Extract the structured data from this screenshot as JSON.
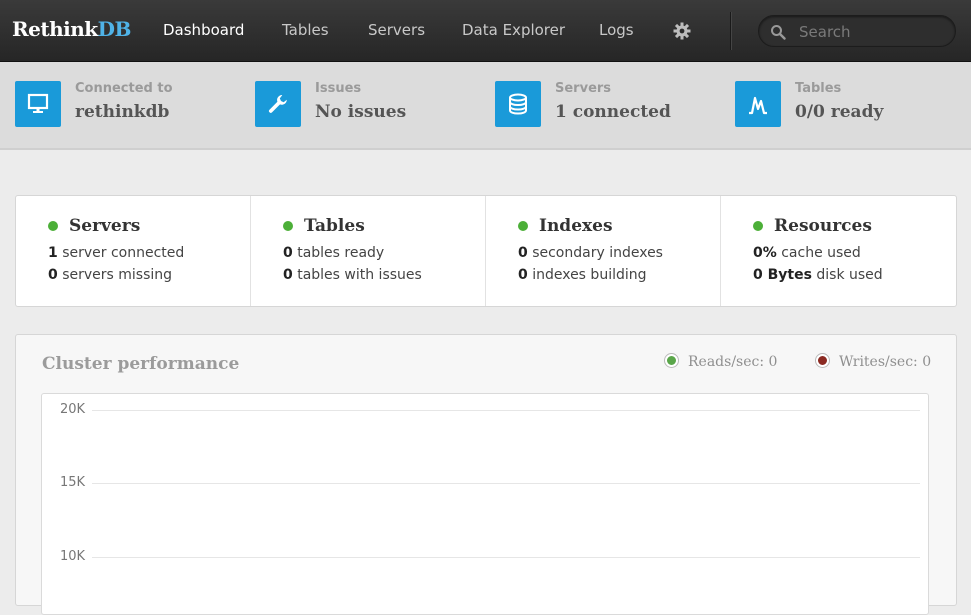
{
  "brand": {
    "part1": "Rethink",
    "part2": "DB"
  },
  "nav": {
    "items": [
      {
        "label": "Dashboard",
        "active": true
      },
      {
        "label": "Tables",
        "active": false
      },
      {
        "label": "Servers",
        "active": false
      },
      {
        "label": "Data Explorer",
        "active": false
      },
      {
        "label": "Logs",
        "active": false
      }
    ],
    "settings_icon": "gear-icon",
    "search_placeholder": "Search"
  },
  "status": [
    {
      "label": "Connected to",
      "value": "rethinkdb",
      "icon": "monitor-icon"
    },
    {
      "label": "Issues",
      "value": "No issues",
      "icon": "wrench-icon"
    },
    {
      "label": "Servers",
      "value": "1 connected",
      "icon": "database-icon"
    },
    {
      "label": "Tables",
      "value": "0/0 ready",
      "icon": "pulse-icon"
    }
  ],
  "summary": {
    "servers": {
      "title": "Servers",
      "l1_num": "1",
      "l1_text": " server connected",
      "l2_num": "0",
      "l2_text": " servers missing"
    },
    "tables": {
      "title": "Tables",
      "l1_num": "0",
      "l1_text": " tables ready",
      "l2_num": "0",
      "l2_text": " tables with issues"
    },
    "indexes": {
      "title": "Indexes",
      "l1_num": "0",
      "l1_text": " secondary indexes",
      "l2_num": "0",
      "l2_text": " indexes building"
    },
    "resources": {
      "title": "Resources",
      "l1_num": "0%",
      "l1_text": " cache used",
      "l2_num": "0 Bytes",
      "l2_text": " disk used"
    }
  },
  "colors": {
    "accent": "#1a9ad9",
    "ok": "#4caf38",
    "reads": "#5aa64a",
    "writes": "#8b2a22"
  },
  "performance": {
    "title": "Cluster performance",
    "reads_label": "Reads/sec: 0",
    "writes_label": "Writes/sec: 0",
    "y_ticks": [
      "20K",
      "15K",
      "10K"
    ]
  }
}
